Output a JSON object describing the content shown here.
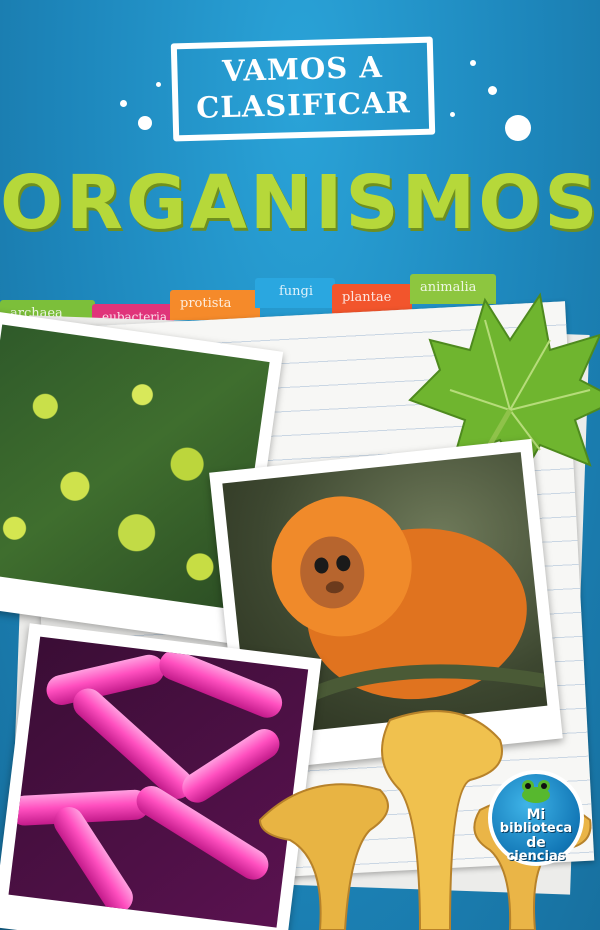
{
  "cover": {
    "series_line1": "VAMOS A",
    "series_line2": "CLASIFICAR",
    "title": "ORGANISMOS",
    "tabs": [
      "archaea",
      "eubacteria",
      "protista",
      "fungi",
      "plantae",
      "animalia"
    ],
    "badge": {
      "line1": "Mi",
      "line2": "biblioteca",
      "line3": "de",
      "line4": "ciencias",
      "icon": "frog-icon"
    },
    "colors": {
      "background": "#1f8fc4",
      "title": "#b6d83a",
      "tab_archaea": "#7cbf3a",
      "tab_eubacteria": "#e0347a",
      "tab_protista": "#f58a2a",
      "tab_fungi": "#2aa7e0",
      "tab_plantae": "#f2552c",
      "tab_animalia": "#8dc63f"
    }
  }
}
